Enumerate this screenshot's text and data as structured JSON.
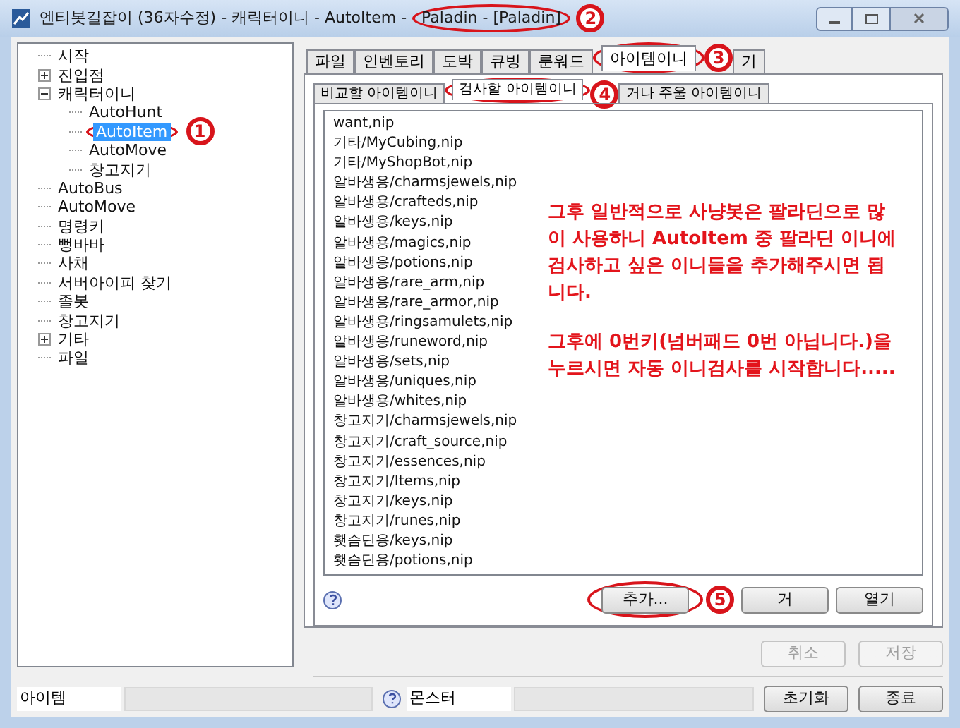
{
  "window": {
    "title": "엔티봇길잡이 (36자수정) - 캐릭터이니 - AutoItem - ",
    "title_tail": "Paladin - [Paladin]"
  },
  "tree": [
    {
      "label": "시작",
      "selected": false
    },
    {
      "label": "진입점",
      "selected": false,
      "expanded": false
    },
    {
      "label": "캐릭터이니",
      "selected": false,
      "expanded": true,
      "children": [
        {
          "label": "AutoHunt",
          "selected": false
        },
        {
          "label": "AutoItem",
          "selected": true
        },
        {
          "label": "AutoMove",
          "selected": false
        },
        {
          "label": "창고지기",
          "selected": false
        }
      ]
    },
    {
      "label": "AutoBus",
      "selected": false
    },
    {
      "label": "AutoMove",
      "selected": false
    },
    {
      "label": "명령키",
      "selected": false
    },
    {
      "label": "뻥바바",
      "selected": false
    },
    {
      "label": "사채",
      "selected": false
    },
    {
      "label": "서버아이피 찾기",
      "selected": false
    },
    {
      "label": "졸봇",
      "selected": false
    },
    {
      "label": "창고지기",
      "selected": false
    },
    {
      "label": "기타",
      "selected": false,
      "expanded": false
    },
    {
      "label": "파일",
      "selected": false
    }
  ],
  "tabs": [
    {
      "label": "파일",
      "selected": false
    },
    {
      "label": "인벤토리",
      "selected": false
    },
    {
      "label": "도박",
      "selected": false
    },
    {
      "label": "큐빙",
      "selected": false
    },
    {
      "label": "룬워드",
      "selected": false
    },
    {
      "label": "아이템이니",
      "selected": true
    },
    {
      "label": "기",
      "selected": false
    }
  ],
  "subtabs": [
    {
      "label": "비교할 아이템이니",
      "selected": false
    },
    {
      "label": "검사할 아이템이니",
      "selected": true
    },
    {
      "label": "거나 주울 아이템이니",
      "selected": false
    }
  ],
  "files": [
    "want,nip",
    "기타/MyCubing,nip",
    "기타/MyShopBot,nip",
    "알바생용/charmsjewels,nip",
    "알바생용/crafteds,nip",
    "알바생용/keys,nip",
    "알바생용/magics,nip",
    "알바생용/potions,nip",
    "알바생용/rare_arm,nip",
    "알바생용/rare_armor,nip",
    "알바생용/ringsamulets,nip",
    "알바생용/runeword,nip",
    "알바생용/sets,nip",
    "알바생용/uniques,nip",
    "알바생용/whites,nip",
    "창고지기/charmsjewels,nip",
    "창고지기/craft_source,nip",
    "창고지기/essences,nip",
    "창고지기/Items,nip",
    "창고지기/keys,nip",
    "창고지기/runes,nip",
    "횃슴딘용/keys,nip",
    "횃슴딘용/potions,nip"
  ],
  "list_buttons": [
    {
      "label": "추가...",
      "disabled": false
    },
    {
      "label": "거",
      "disabled": false
    },
    {
      "label": "열기",
      "disabled": false
    }
  ],
  "form_buttons": [
    {
      "label": "취소",
      "disabled": true
    },
    {
      "label": "저장",
      "disabled": true
    }
  ],
  "status_bar": {
    "item_field": "아이템",
    "monster_field": "몬스터",
    "buttons": [
      "초기화",
      "종료"
    ]
  },
  "notes": [
    "그후 일반적으로 사냥봇은 팔라딘으로 많이 사용하니 AutoItem 중 팔라딘 이니에 검사하고 싶은 이니들을 추가해주시면 됩니다.",
    "그후에 0번키(넘버패드 0번 아닙니다.)을 누르시면 자동 이니검사를 시작합니다....."
  ],
  "markers": [
    "1",
    "2",
    "3",
    "4",
    "5"
  ]
}
